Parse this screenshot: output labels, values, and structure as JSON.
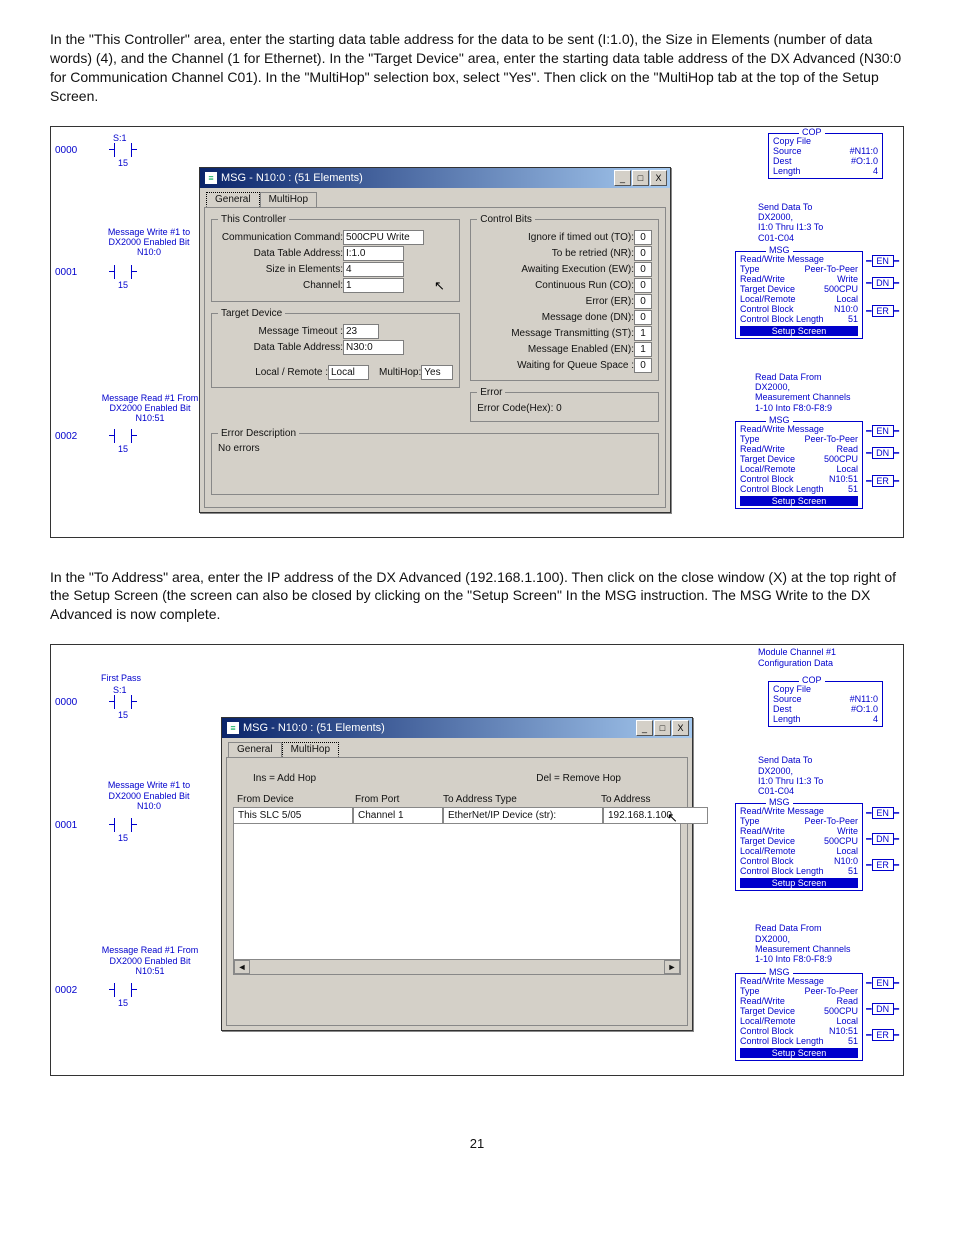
{
  "para1": "In the \"This Controller\" area, enter the starting data table address for the data to be sent (I:1.0), the Size in Elements (number of data words) (4), and the Channel (1 for Ethernet). In the \"Target Device\" area, enter the starting data table address of the DX Advanced (N30:0 for Communication Channel C01). In the \"MultiHop\" selection box, select \"Yes\". Then click on the \"MultiHop tab at the top of the Setup Screen.",
  "para2": "In the \"To Address\" area, enter the IP address of the DX Advanced (192.168.1.100). Then click on the close window (X) at the top right of the Setup Screen (the screen can also be closed by clicking on the \"Setup Screen\" In the MSG instruction. The MSG Write to the DX Advanced is now complete.",
  "pagenum": "21",
  "dlg": {
    "title": "MSG - N10:0 : (51 Elements)",
    "tabs": {
      "general": "General",
      "multihop": "MultiHop"
    },
    "winbtns": {
      "min": "_",
      "max": "□",
      "close": "X"
    }
  },
  "fig1": {
    "rungs": {
      "r0": "0000",
      "r1": "0001",
      "r2": "0002"
    },
    "contacts": {
      "c0": {
        "top": "S:1",
        "bot": "15"
      },
      "c1": {
        "lines": "Message Write #1 to\nDX2000 Enabled Bit\nN10:0",
        "bot": "15"
      },
      "c2": {
        "lines": "Message Read #1 From\nDX2000 Enabled Bit\nN10:51",
        "bot": "15"
      }
    },
    "thisController": {
      "legend": "This Controller",
      "cmd_l": "Communication Command:",
      "cmd_v": "500CPU Write",
      "addr_l": "Data Table Address:",
      "addr_v": "I:1.0",
      "size_l": "Size in Elements:",
      "size_v": "4",
      "chan_l": "Channel:",
      "chan_v": "1"
    },
    "target": {
      "legend": "Target Device",
      "to_l": "Message Timeout :",
      "to_v": "23",
      "addr_l": "Data Table Address:",
      "addr_v": "N30:0",
      "lr_l": "Local / Remote :",
      "lr_v": "Local",
      "mh_l": "MultiHop:",
      "mh_v": "Yes"
    },
    "controlBits": {
      "legend": "Control Bits",
      "rows": [
        [
          "Ignore if timed out (TO):",
          "0"
        ],
        [
          "To be retried (NR):",
          "0"
        ],
        [
          "Awaiting Execution (EW):",
          "0"
        ],
        [
          "Continuous Run (CO):",
          "0"
        ],
        [
          "Error (ER):",
          "0"
        ],
        [
          "Message done (DN):",
          "0"
        ],
        [
          "Message Transmitting (ST):",
          "1"
        ],
        [
          "Message Enabled (EN):",
          "1"
        ],
        [
          "Waiting for Queue Space :",
          "0"
        ]
      ]
    },
    "error": {
      "legend": "Error",
      "code_l": "Error Code(Hex):",
      "code_v": "0"
    },
    "errDesc": {
      "legend": "Error Description",
      "text": "No errors"
    },
    "cop": {
      "title": "COP",
      "name": "Copy File",
      "src_l": "Source",
      "src_v": "#N11:0",
      "dst_l": "Dest",
      "dst_v": "#O:1.0",
      "len_l": "Length",
      "len_v": "4"
    },
    "sendBox": {
      "header": "Send Data To\nDX2000,\nI1:0 Thru I1:3 To\nC01-C04",
      "title": "MSG",
      "rows": [
        [
          "Read/Write Message",
          ""
        ],
        [
          "Type",
          "Peer-To-Peer"
        ],
        [
          "Read/Write",
          "Write"
        ],
        [
          "Target Device",
          "500CPU"
        ],
        [
          "Local/Remote",
          "Local"
        ],
        [
          "Control Block",
          "N10:0"
        ],
        [
          "Control Block Length",
          "51"
        ]
      ],
      "setup": "Setup Screen"
    },
    "readBox": {
      "header": "Read Data From\nDX2000,\nMeasurement Channels\n1-10 Into F8:0-F8:9",
      "title": "MSG",
      "rows": [
        [
          "Read/Write Message",
          ""
        ],
        [
          "Type",
          "Peer-To-Peer"
        ],
        [
          "Read/Write",
          "Read"
        ],
        [
          "Target Device",
          "500CPU"
        ],
        [
          "Local/Remote",
          "Local"
        ],
        [
          "Control Block",
          "N10:51"
        ],
        [
          "Control Block Length",
          "51"
        ]
      ],
      "setup": "Setup Screen"
    },
    "pins": {
      "en": "EN",
      "dn": "DN",
      "er": "ER"
    }
  },
  "fig2": {
    "pretext": "Module Channel #1\nConfiguration Data",
    "first_pass": "First Pass",
    "rungs": {
      "r0": "0000",
      "r1": "0001",
      "r2": "0002"
    },
    "table": {
      "ins": "Ins = Add Hop",
      "del": "Del = Remove Hop",
      "h1": "From Device",
      "h2": "From Port",
      "h3": "To Address Type",
      "h4": "To Address",
      "r1": "This SLC 5/05",
      "r2": "Channel 1",
      "r3": "EtherNet/IP Device (str):",
      "r4": "192.168.1.100"
    },
    "readBox2Header": "Read Data From\nDX2000,\nMeasurement Channels\n1-10 Into F8:0-F8:9"
  }
}
